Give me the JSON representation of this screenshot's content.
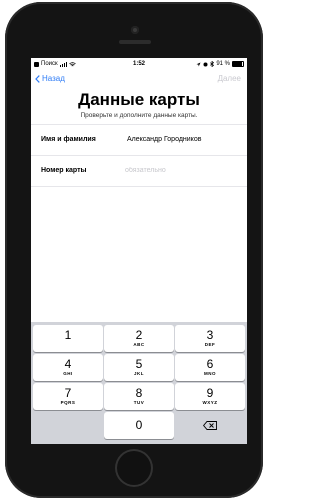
{
  "status_bar": {
    "carrier": "Поиск",
    "time": "1:52",
    "battery": "91 %",
    "battery_level": 0.91
  },
  "nav": {
    "back_label": "Назад",
    "next_label": "Далее"
  },
  "header": {
    "title": "Данные карты",
    "subtitle": "Проверьте и дополните данные карты."
  },
  "form": {
    "name_label": "Имя и фамилия",
    "name_value": "Александр Городников",
    "card_label": "Номер карты",
    "card_placeholder": "обязательно",
    "card_value": ""
  },
  "keypad": {
    "keys": [
      {
        "num": "1",
        "letters": ""
      },
      {
        "num": "2",
        "letters": "ABC"
      },
      {
        "num": "3",
        "letters": "DEF"
      },
      {
        "num": "4",
        "letters": "GHI"
      },
      {
        "num": "5",
        "letters": "JKL"
      },
      {
        "num": "6",
        "letters": "MNO"
      },
      {
        "num": "7",
        "letters": "PQRS"
      },
      {
        "num": "8",
        "letters": "TUV"
      },
      {
        "num": "9",
        "letters": "WXYZ"
      },
      {
        "num": "0",
        "letters": ""
      }
    ],
    "delete_icon": "backspace-icon"
  },
  "colors": {
    "accent": "#2f7cf6",
    "disabled": "#c9c9cf",
    "keyboard_bg": "#d1d3d9"
  }
}
